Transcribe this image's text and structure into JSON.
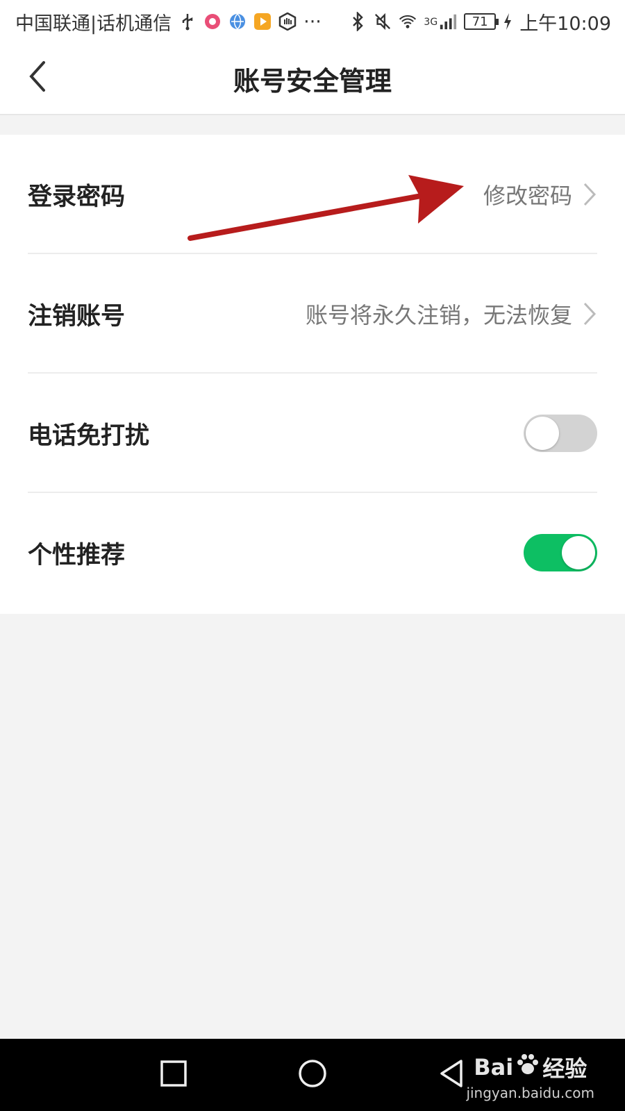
{
  "status_bar": {
    "carrier": "中国联通|话机通信",
    "dots": "···",
    "network": "3G",
    "battery": "71",
    "time": "上午10:09"
  },
  "header": {
    "title": "账号安全管理"
  },
  "settings": [
    {
      "label": "登录密码",
      "value": "修改密码",
      "type": "link"
    },
    {
      "label": "注销账号",
      "value": "账号将永久注销，无法恢复",
      "type": "link"
    },
    {
      "label": "电话免打扰",
      "type": "toggle",
      "enabled": false
    },
    {
      "label": "个性推荐",
      "type": "toggle",
      "enabled": true
    }
  ],
  "colors": {
    "toggle_on": "#0dbf63",
    "toggle_off": "#d3d3d3",
    "annotation_arrow": "#b71c1c"
  },
  "watermark": {
    "brand": "Bai",
    "brand_suffix": "经验",
    "url": "jingyan.baidu.com"
  },
  "icons": [
    "usb-icon",
    "app-notification-icon",
    "browser-icon",
    "video-icon",
    "hand-icon",
    "bluetooth-icon",
    "mute-icon",
    "wifi-icon",
    "signal-icon",
    "charging-icon",
    "back-arrow-icon",
    "chevron-right-icon",
    "recent-apps-icon",
    "home-icon",
    "nav-back-icon",
    "paw-icon"
  ]
}
